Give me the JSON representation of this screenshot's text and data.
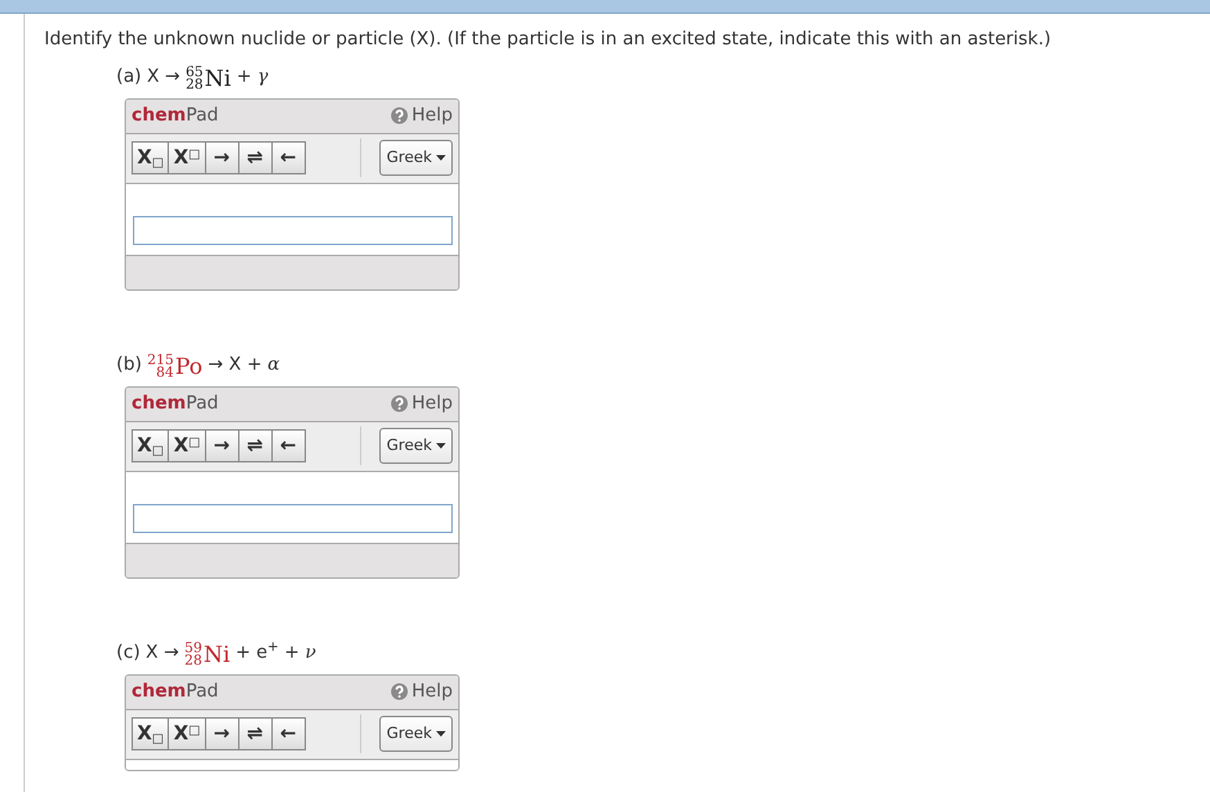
{
  "instruction": "Identify the unknown nuclide or particle (X). (If the particle is in an excited state, indicate this with an asterisk.)",
  "parts": [
    {
      "label": "(a)",
      "equation": [
        {
          "kind": "text",
          "text": "X →"
        },
        {
          "kind": "nuclide",
          "mass": "65",
          "atomic": "28",
          "symbol": "Ni",
          "color": "#222222"
        },
        {
          "kind": "text",
          "text": "+"
        },
        {
          "kind": "italic",
          "text": "γ"
        }
      ],
      "pad": {
        "brand_bold": "chem",
        "brand_rest": "Pad",
        "help": "Help",
        "tools": [
          "X$_{□}$",
          "X$^{□}$",
          "→",
          "⇌",
          "←"
        ],
        "greek": "Greek",
        "answer_visible": true
      }
    },
    {
      "label": "(b)",
      "equation": [
        {
          "kind": "nuclide",
          "mass": "215",
          "atomic": "84",
          "symbol": "Po",
          "color": "#c0282d"
        },
        {
          "kind": "text",
          "text": "→ X +"
        },
        {
          "kind": "italic",
          "text": "α"
        }
      ],
      "pad": {
        "brand_bold": "chem",
        "brand_rest": "Pad",
        "help": "Help",
        "tools": [
          "X$_{□}$",
          "X$^{□}$",
          "→",
          "⇌",
          "←"
        ],
        "greek": "Greek",
        "answer_visible": true
      }
    },
    {
      "label": "(c)",
      "equation": [
        {
          "kind": "text",
          "text": "X →"
        },
        {
          "kind": "nuclide",
          "mass": "59",
          "atomic": "28",
          "symbol": "Ni",
          "color": "#c0282d"
        },
        {
          "kind": "text",
          "text": "+ e$^{+}$ +"
        },
        {
          "kind": "italic",
          "text": "ν"
        }
      ],
      "pad": {
        "brand_bold": "chem",
        "brand_rest": "Pad",
        "help": "Help",
        "tools": [
          "X$_{□}$",
          "X$^{□}$",
          "→",
          "⇌",
          "←"
        ],
        "greek": "Greek",
        "answer_visible": false
      }
    }
  ]
}
